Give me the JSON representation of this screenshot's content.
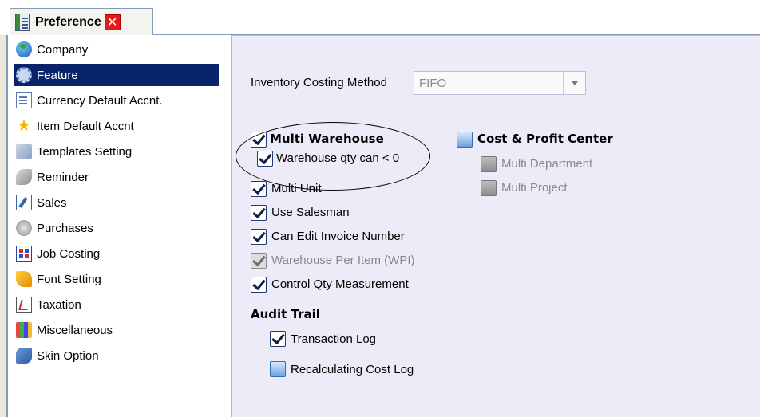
{
  "tab": {
    "title": "Preference",
    "close": "✕"
  },
  "sidebar": {
    "items": [
      {
        "label": "Company",
        "icon": "globe-icon"
      },
      {
        "label": "Feature",
        "icon": "gear-icon",
        "selected": true
      },
      {
        "label": "Currency Default Accnt.",
        "icon": "document-icon"
      },
      {
        "label": "Item Default Accnt",
        "icon": "star-icon"
      },
      {
        "label": "Templates Setting",
        "icon": "templates-icon"
      },
      {
        "label": "Reminder",
        "icon": "reminder-icon"
      },
      {
        "label": "Sales",
        "icon": "sales-icon"
      },
      {
        "label": "Purchases",
        "icon": "purchases-icon"
      },
      {
        "label": "Job Costing",
        "icon": "job-costing-icon"
      },
      {
        "label": "Font Setting",
        "icon": "font-icon"
      },
      {
        "label": "Taxation",
        "icon": "taxation-icon"
      },
      {
        "label": "Miscellaneous",
        "icon": "miscellaneous-icon"
      },
      {
        "label": "Skin Option",
        "icon": "skin-icon"
      }
    ]
  },
  "main": {
    "costing_label": "Inventory Costing Method",
    "costing_value": "FIFO",
    "multi_warehouse": "Multi Warehouse",
    "warehouse_qty": "Warehouse qty can < 0",
    "multi_unit": "Multi Unit",
    "use_salesman": "Use Salesman",
    "edit_invoice": "Can Edit Invoice Number",
    "warehouse_per_item": "Warehouse Per Item (WPI)",
    "control_qty": "Control Qty Measurement",
    "audit_trail": "Audit Trail",
    "transaction_log": "Transaction Log",
    "recalc_cost_log": "Recalculating Cost Log",
    "cost_profit_center": "Cost & Profit Center",
    "multi_department": "Multi Department",
    "multi_project": "Multi Project"
  },
  "colors": {
    "selected_bg": "#0a246a",
    "panel_bg": "#ecebf7",
    "close_red": "#e8191a"
  }
}
